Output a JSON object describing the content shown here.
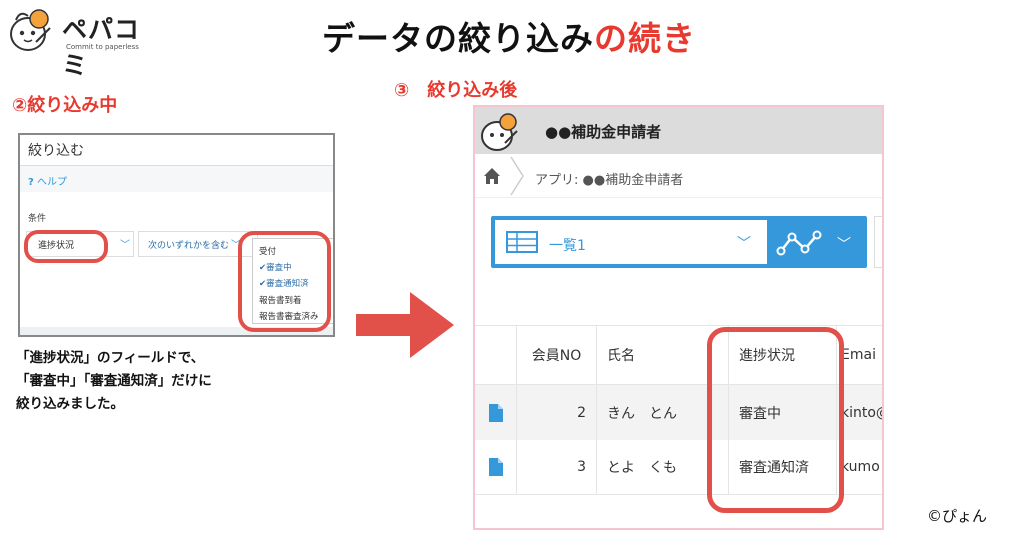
{
  "logo": {
    "text": "ペパコミ",
    "tagline": "Commit to paperless"
  },
  "title": {
    "part1": "データの絞り込み",
    "part2": "の続き"
  },
  "section_labels": {
    "during": "②絞り込み中",
    "after": "③　絞り込み後"
  },
  "filter_panel": {
    "title": "絞り込む",
    "help_icon": "?",
    "help": "ヘルプ",
    "condition_label": "条件",
    "field": "進捗状況",
    "operator": "次のいずれかを含む",
    "options": [
      {
        "label": "受付",
        "checked": false
      },
      {
        "label": "審査中",
        "checked": true
      },
      {
        "label": "審査通知済",
        "checked": true
      },
      {
        "label": "報告書到着",
        "checked": false
      },
      {
        "label": "報告書審査済み",
        "checked": false
      }
    ],
    "check_mark": "✔"
  },
  "caption": {
    "line1": "「進捗状況」のフィールドで、",
    "line2": "「審査中」「審査通知済」だけに",
    "line3": "絞り込みました。"
  },
  "app_screen": {
    "header_title": "●●補助金申請者",
    "breadcrumb": "アプリ: ●●補助金申請者",
    "view_name": "一覧1",
    "table": {
      "headers": [
        "会員NO",
        "氏名",
        "進捗状況",
        "Emai"
      ],
      "rows": [
        {
          "no": "2",
          "name": "きん　とん",
          "status": "審査中",
          "email": "kinto@"
        },
        {
          "no": "3",
          "name": "とよ　くも",
          "status": "審査通知済",
          "email": "kumo"
        }
      ]
    }
  },
  "highlight_color": "#e2504a",
  "accent_color": "#3498db",
  "copyright": "©ぴょん"
}
